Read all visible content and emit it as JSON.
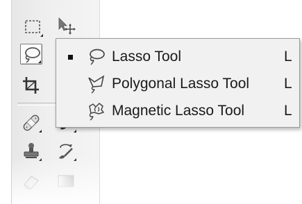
{
  "flyout": {
    "items": [
      {
        "label": "Lasso Tool",
        "shortcut": "L",
        "selected": true,
        "icon": "lasso-icon"
      },
      {
        "label": "Polygonal Lasso Tool",
        "shortcut": "L",
        "selected": false,
        "icon": "polygonal-lasso-icon"
      },
      {
        "label": "Magnetic Lasso Tool",
        "shortcut": "L",
        "selected": false,
        "icon": "magnetic-lasso-icon"
      }
    ]
  },
  "toolbox": {
    "tools": [
      {
        "name": "marquee-tool",
        "icon": "marquee-icon"
      },
      {
        "name": "move-tool",
        "icon": "move-icon"
      },
      {
        "name": "lasso-tool",
        "icon": "lasso-icon",
        "active": true
      },
      {
        "name": "crop-tool",
        "icon": "crop-icon"
      },
      {
        "name": "healing-brush-tool",
        "icon": "bandage-icon"
      },
      {
        "name": "brush-tool",
        "icon": "brush-icon"
      },
      {
        "name": "clone-stamp-tool",
        "icon": "stamp-icon"
      },
      {
        "name": "history-brush-tool",
        "icon": "history-brush-icon"
      },
      {
        "name": "eraser-tool",
        "icon": "eraser-icon"
      },
      {
        "name": "gradient-tool",
        "icon": "gradient-icon"
      }
    ]
  },
  "colors": {
    "panel": "#efefef",
    "menu": "#f1f1f1",
    "text": "#1a1a1a"
  }
}
